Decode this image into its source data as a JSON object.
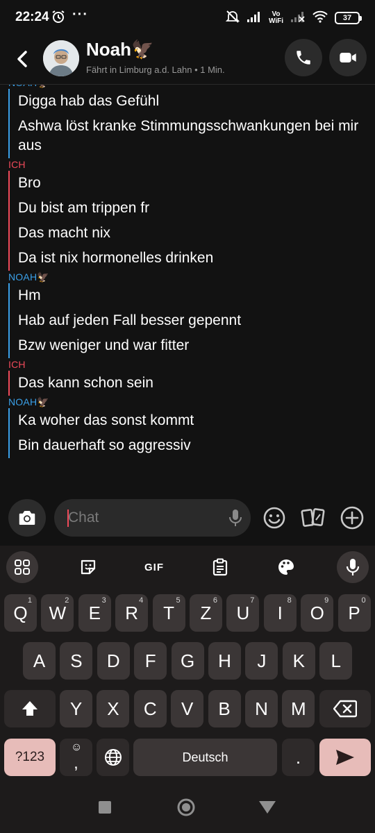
{
  "status_bar": {
    "time": "22:24",
    "more": "···",
    "vowifi_line1": "Vo",
    "vowifi_line2": "WiFi",
    "battery": "37"
  },
  "header": {
    "name": "Noah🦅",
    "status": "Fährt in Limburg a.d. Lahn • 1 Min."
  },
  "messages": [
    {
      "sender": "NOAH🦅",
      "side": "noah",
      "lines": [
        "Digga hab das Gefühl",
        "Ashwa löst kranke Stimmungsschwankungen bei mir aus"
      ]
    },
    {
      "sender": "ICH",
      "side": "me",
      "lines": [
        "Bro",
        "Du bist am trippen fr",
        "Das macht nix",
        "Da ist nix hormonelles drinken"
      ]
    },
    {
      "sender": "NOAH🦅",
      "side": "noah",
      "lines": [
        "Hm",
        "Hab auf jeden Fall besser gepennt",
        "Bzw weniger und war fitter"
      ]
    },
    {
      "sender": "ICH",
      "side": "me",
      "lines": [
        "Das kann schon sein"
      ]
    },
    {
      "sender": "NOAH🦅",
      "side": "noah",
      "lines": [
        "Ka woher das sonst kommt",
        "Bin dauerhaft so aggressiv"
      ]
    }
  ],
  "composer": {
    "placeholder": "Chat"
  },
  "keyboard": {
    "toolbar_gif": "GIF",
    "row1": [
      {
        "k": "Q",
        "h": "1"
      },
      {
        "k": "W",
        "h": "2"
      },
      {
        "k": "E",
        "h": "3"
      },
      {
        "k": "R",
        "h": "4"
      },
      {
        "k": "T",
        "h": "5"
      },
      {
        "k": "Z",
        "h": "6"
      },
      {
        "k": "U",
        "h": "7"
      },
      {
        "k": "I",
        "h": "8"
      },
      {
        "k": "O",
        "h": "9"
      },
      {
        "k": "P",
        "h": "0"
      }
    ],
    "row2": [
      "A",
      "S",
      "D",
      "F",
      "G",
      "H",
      "J",
      "K",
      "L"
    ],
    "row3": [
      "Y",
      "X",
      "C",
      "V",
      "B",
      "N",
      "M"
    ],
    "numbers_key": "?123",
    "comma_key": ",",
    "comma_hint": "☺",
    "space_label": "Deutsch",
    "period_key": "."
  }
}
